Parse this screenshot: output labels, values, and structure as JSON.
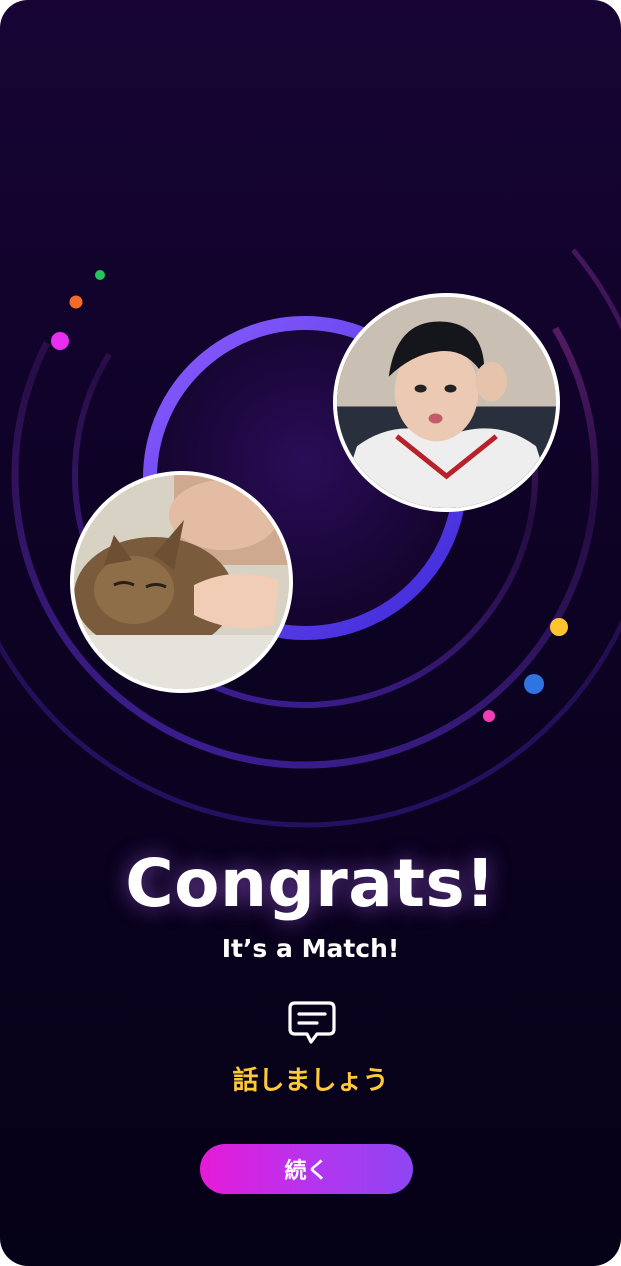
{
  "match": {
    "title": "Congrats!",
    "subtitle": "It’s a Match!"
  },
  "chat": {
    "icon": "chat-bubble-icon",
    "label": "話しましょう"
  },
  "continue_button": {
    "label": "続く"
  },
  "profiles": {
    "user_photo": "cat-with-person-photo",
    "match_photo": "woman-selfie-photo"
  },
  "colors": {
    "background_top": "#170435",
    "background_bottom": "#050116",
    "ring_violet": "#7a52f5",
    "ring_magenta": "#c3389f",
    "chat_label": "#ffc93a",
    "button_start": "#e61bd8",
    "button_end": "#8d46f2"
  }
}
